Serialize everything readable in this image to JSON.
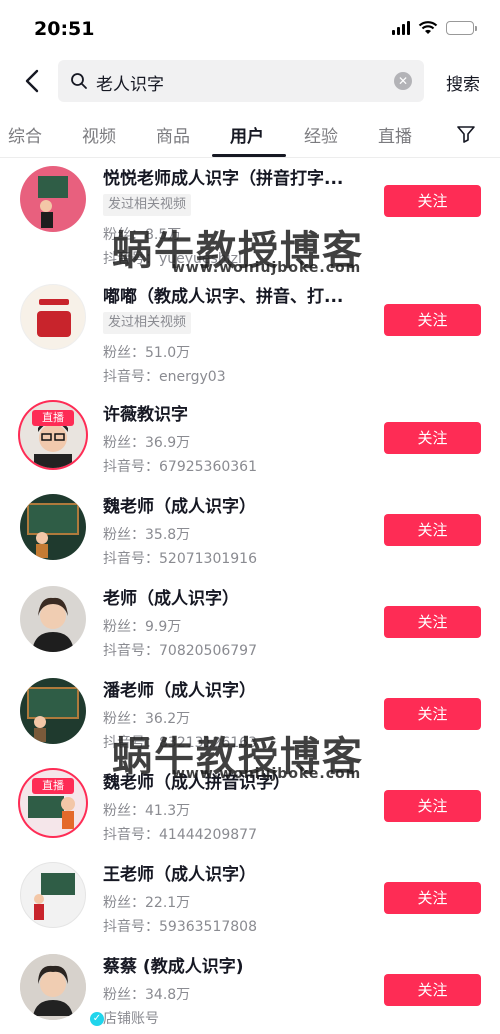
{
  "status": {
    "time": "20:51"
  },
  "search": {
    "query": "老人识字",
    "button_label": "搜索"
  },
  "tabs": [
    {
      "label": "综合"
    },
    {
      "label": "视频"
    },
    {
      "label": "商品"
    },
    {
      "label": "用户",
      "active": true
    },
    {
      "label": "经验"
    },
    {
      "label": "直播"
    }
  ],
  "follow_label": "关注",
  "users": [
    {
      "name": "悦悦老师成人识字（拼音打字...",
      "tag": "发过相关视频",
      "fans": "粉丝：8.5万",
      "id": "抖音号：yueyueshizi"
    },
    {
      "name": "嘟嘟（教成人识字、拼音、打...",
      "tag": "发过相关视频",
      "fans": "粉丝：51.0万",
      "id": "抖音号：energy03",
      "avatar_text": "dū 嘟"
    },
    {
      "name": "许薇教识字",
      "fans": "粉丝：36.9万",
      "id": "抖音号：67925360361",
      "live": "直播"
    },
    {
      "name": "魏老师（成人识字）",
      "fans": "粉丝：35.8万",
      "id": "抖音号：52071301916"
    },
    {
      "name": "老师（成人识字）",
      "fans": "粉丝：9.9万",
      "id": "抖音号：70820506797"
    },
    {
      "name": "潘老师（成人识字）",
      "fans": "粉丝：36.2万",
      "id": "抖音号：83213126163"
    },
    {
      "name": "魏老师（成人拼音识字）",
      "fans": "粉丝：41.3万",
      "id": "抖音号：41444209877",
      "live": "直播"
    },
    {
      "name": "王老师（成人识字）",
      "fans": "粉丝：22.1万",
      "id": "抖音号：59363517808"
    },
    {
      "name": "蔡蔡 (教成人识字)",
      "fans": "粉丝：34.8万",
      "id": "店铺账号"
    }
  ],
  "watermark": {
    "main": "蜗牛教授博客",
    "sub": "www.woniujboke.com"
  },
  "colors": {
    "accent": "#fe2c55",
    "text": "#161823",
    "muted": "#8a8b91"
  }
}
